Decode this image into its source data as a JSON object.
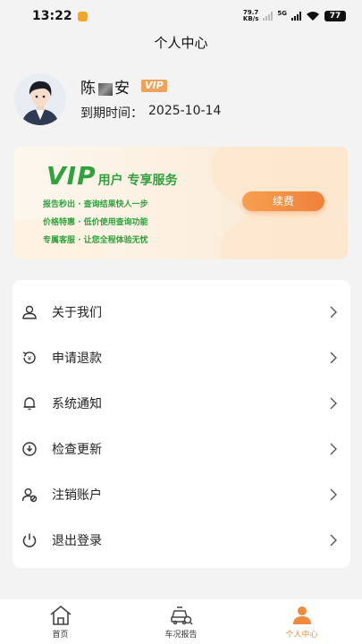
{
  "status_bar": {
    "time": "13:22",
    "net_speed_value": "79.7",
    "net_speed_unit": "KB/s",
    "net_type": "5G",
    "battery": "77"
  },
  "header": {
    "title": "个人中心"
  },
  "profile": {
    "name_first": "陈",
    "name_last": "安",
    "vip_badge": "VIP",
    "expire_label": "到期时间：",
    "expire_date": "2025-10-14"
  },
  "vip_banner": {
    "title_vip": "VIP",
    "title_rest": "用户 专享服务",
    "features": [
      "报告秒出 · 查询结果快人一步",
      "价格特惠 · 低价使用查询功能",
      "专属客服 · 让您全程体验无忧"
    ],
    "renew_label": "续费"
  },
  "menu": {
    "items": [
      {
        "label": "关于我们",
        "icon": "user-icon"
      },
      {
        "label": "申请退款",
        "icon": "refund-icon"
      },
      {
        "label": "系统通知",
        "icon": "bell-icon"
      },
      {
        "label": "检查更新",
        "icon": "update-icon"
      },
      {
        "label": "注销账户",
        "icon": "account-cancel-icon"
      },
      {
        "label": "退出登录",
        "icon": "power-icon"
      }
    ]
  },
  "bottom_nav": {
    "items": [
      {
        "label": "首页",
        "icon": "home-icon"
      },
      {
        "label": "车况报告",
        "icon": "car-report-icon"
      },
      {
        "label": "个人中心",
        "icon": "person-icon",
        "active": true
      }
    ]
  },
  "colors": {
    "accent": "#f08a3c",
    "vip_green": "#2fa13d",
    "badge": "#f1a25a"
  }
}
